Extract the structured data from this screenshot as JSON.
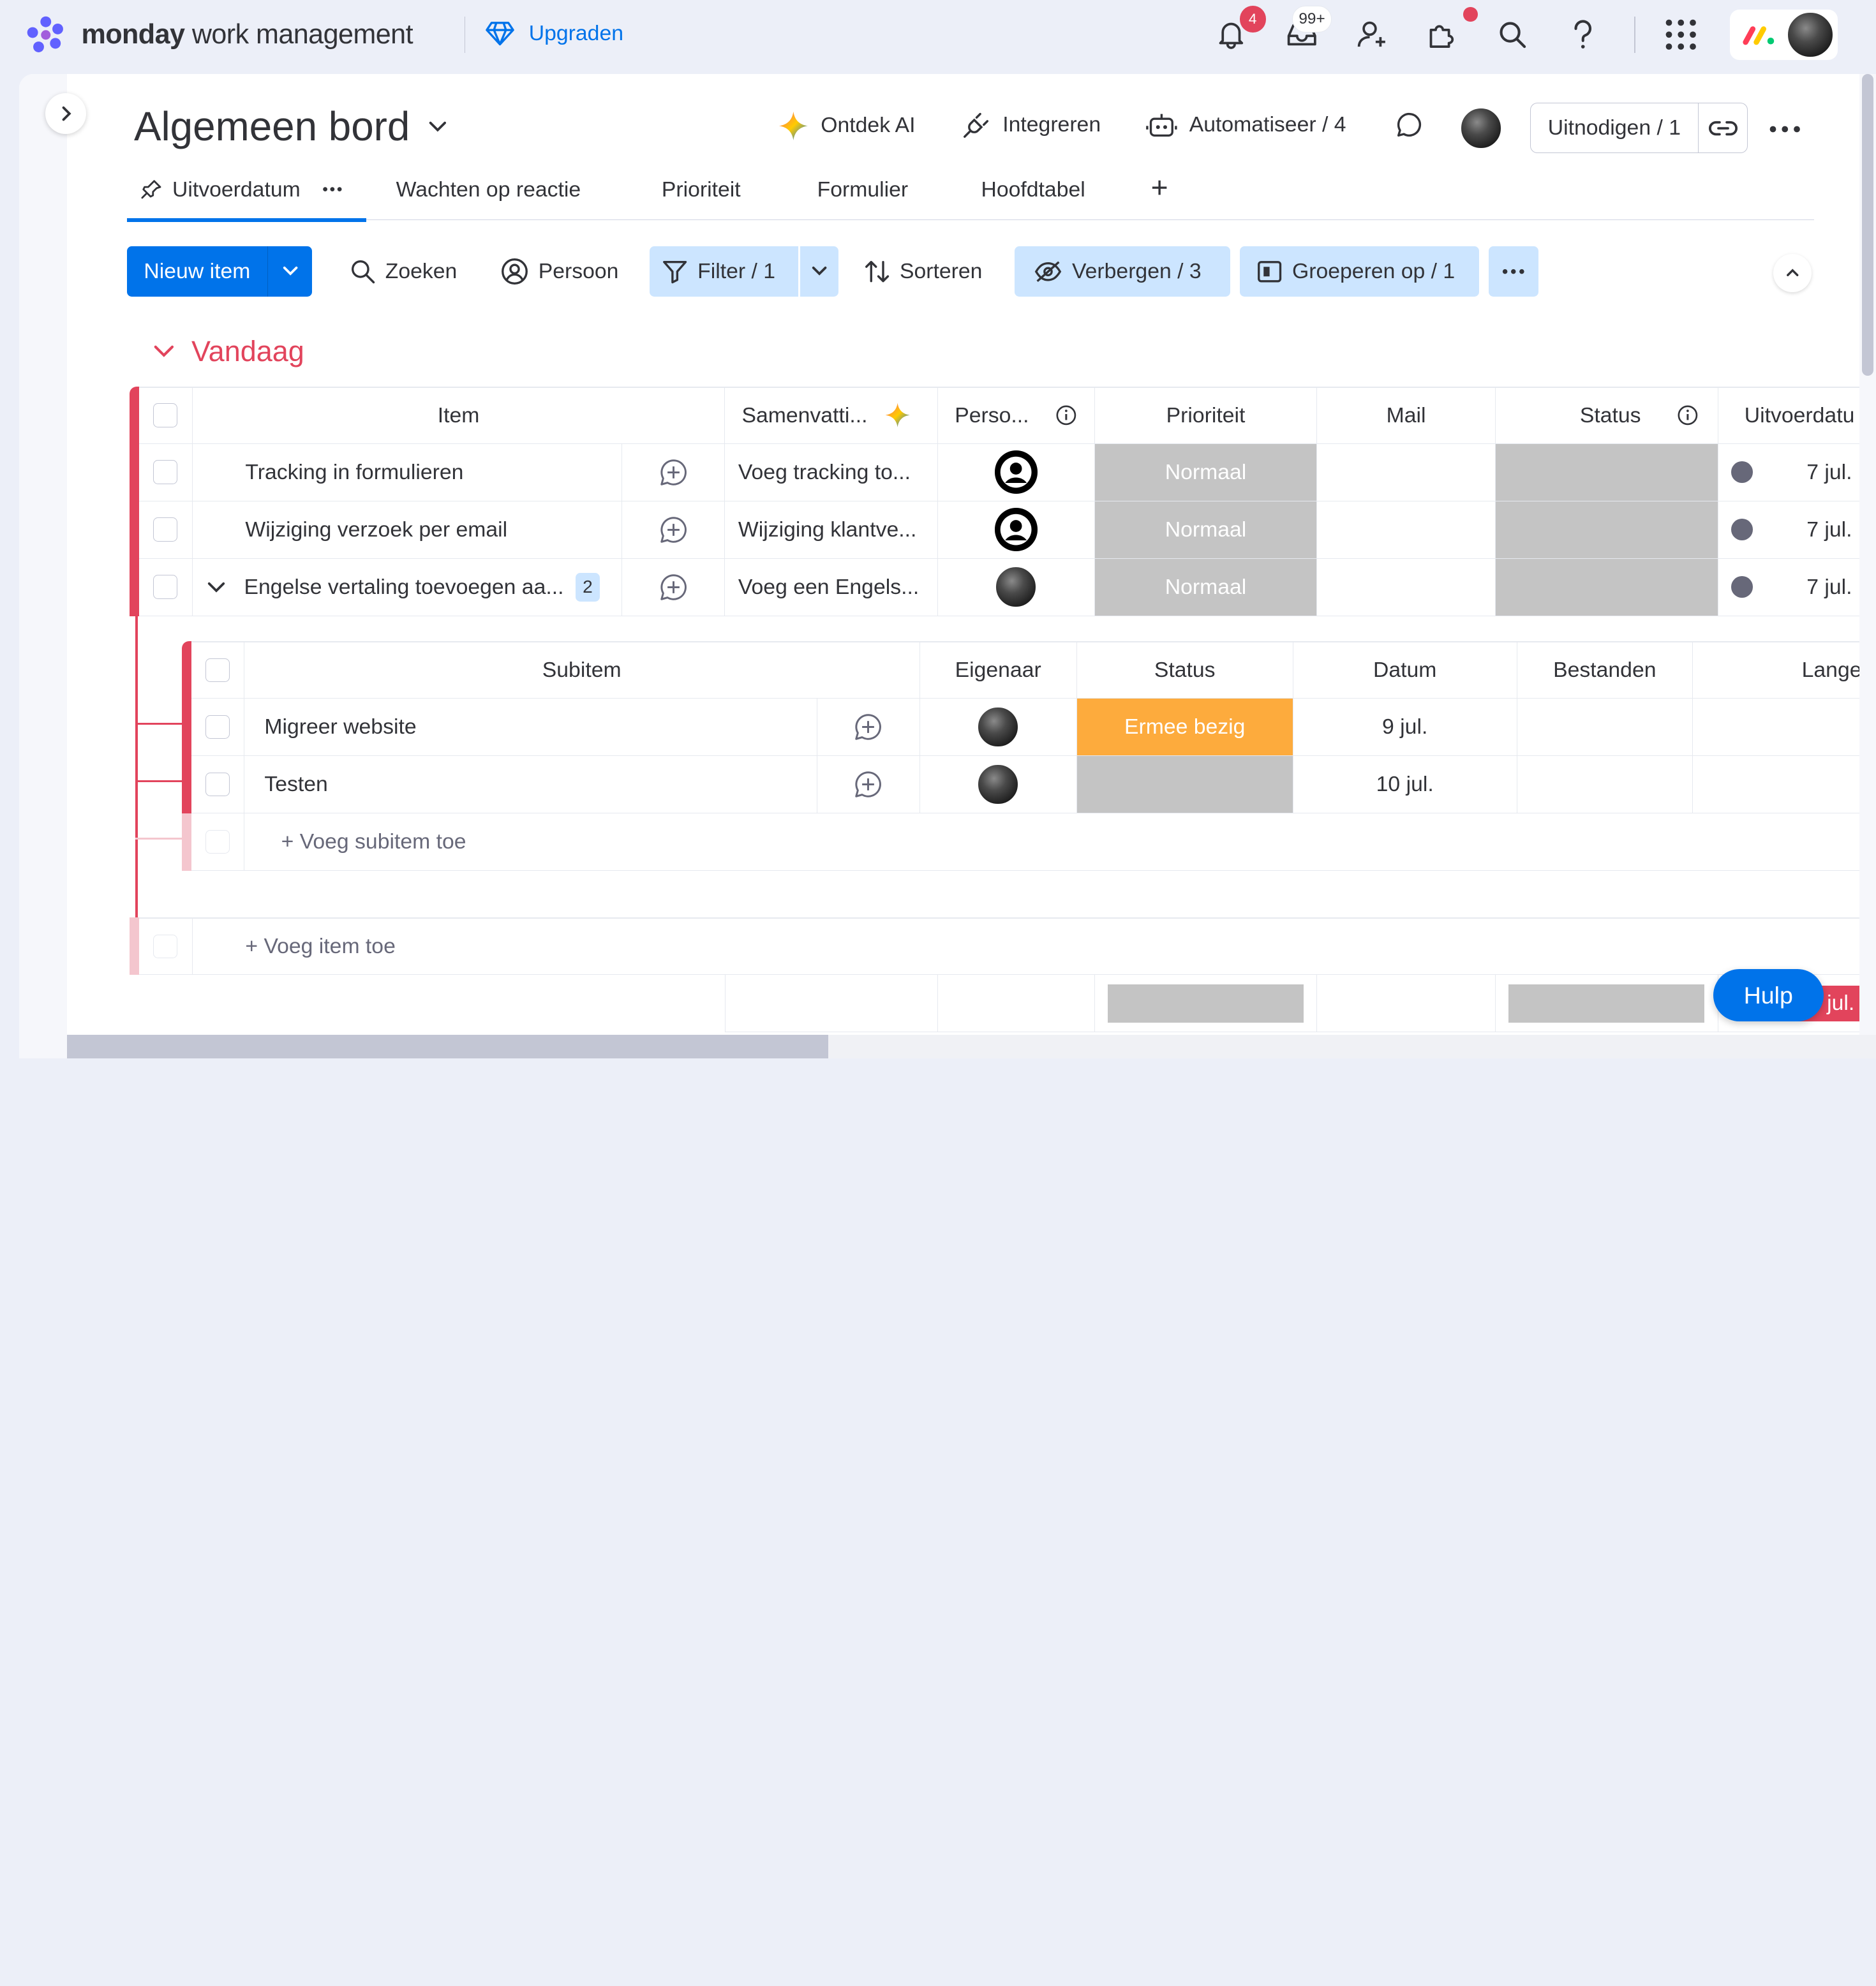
{
  "topbar": {
    "brand_bold": "monday",
    "brand_rest": " work management",
    "upgrade_label": "Upgraden",
    "notifications_count": "4",
    "inbox_count": "99+"
  },
  "board": {
    "title": "Algemeen bord",
    "actions": {
      "ai": "Ontdek AI",
      "integrate": "Integreren",
      "automate": "Automatiseer / 4"
    },
    "invite_label": "Uitnodigen / 1"
  },
  "tabs": [
    {
      "label": "Uitvoerdatum",
      "active": true
    },
    {
      "label": "Wachten op reactie"
    },
    {
      "label": "Prioriteit"
    },
    {
      "label": "Formulier"
    },
    {
      "label": "Hoofdtabel"
    }
  ],
  "toolbar": {
    "new_item": "Nieuw item",
    "search": "Zoeken",
    "person": "Persoon",
    "filter": "Filter / 1",
    "sort": "Sorteren",
    "hide": "Verbergen / 3",
    "group_by": "Groeperen op / 1"
  },
  "group": {
    "title": "Vandaag",
    "color": "#e2445c",
    "columns": {
      "item": "Item",
      "summary": "Samenvatti...",
      "person": "Perso...",
      "priority": "Prioriteit",
      "mail": "Mail",
      "status": "Status",
      "due": "Uitvoerdatu"
    },
    "rows": [
      {
        "name": "Tracking in formulieren",
        "summary": "Voeg tracking to...",
        "priority": "Normaal",
        "date": "7 jul."
      },
      {
        "name": "Wijziging verzoek per email",
        "summary": "Wijziging klantve...",
        "priority": "Normaal",
        "date": "7 jul."
      },
      {
        "name": "Engelse vertaling toevoegen aa...",
        "summary": "Voeg een Engels...",
        "priority": "Normaal",
        "date": "7 jul.",
        "subitem_count": "2"
      }
    ],
    "subitems": {
      "columns": {
        "name": "Subitem",
        "owner": "Eigenaar",
        "status": "Status",
        "date": "Datum",
        "files": "Bestanden",
        "long": "Lange"
      },
      "rows": [
        {
          "name": "Migreer website",
          "status": "Ermee bezig",
          "date": "9 jul."
        },
        {
          "name": "Testen",
          "status": "",
          "date": "10 jul."
        }
      ],
      "add_label": "+ Voeg subitem toe"
    },
    "add_item_label": "+ Voeg item toe",
    "footer_date_partial": "jul."
  },
  "help_label": "Hulp",
  "colors": {
    "accent": "#0073ea",
    "status_working": "#fdab3d",
    "neutral_status": "#c4c4c4"
  }
}
